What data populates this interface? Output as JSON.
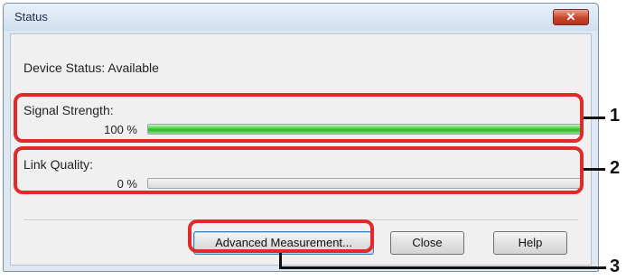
{
  "window": {
    "title": "Status",
    "close_glyph": "✕"
  },
  "device_status": "Device Status: Available",
  "signal": {
    "label": "Signal Strength:",
    "value_text": "100 %",
    "value_fraction": 1.0
  },
  "link": {
    "label": "Link Quality:",
    "value_text": "0 %",
    "value_fraction": 0.0
  },
  "buttons": {
    "advanced": "Advanced Measurement...",
    "close": "Close",
    "help": "Help"
  },
  "callout_numbers": [
    "1",
    "2",
    "3"
  ],
  "colors": {
    "callout": "#e12b2b",
    "bar_fill": "#3fcf38"
  }
}
